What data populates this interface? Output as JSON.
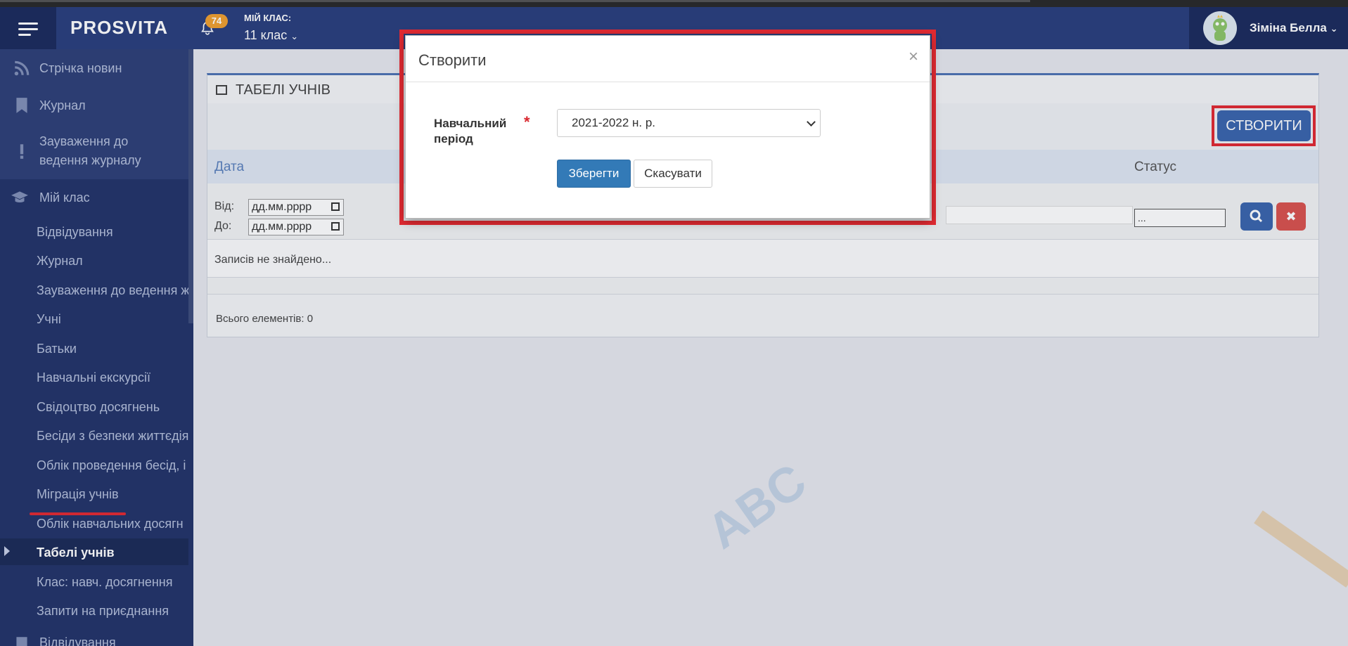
{
  "topbar": {
    "logo": "PROSVITA",
    "notifications_count": "74",
    "my_class_label": "МІЙ КЛАС:",
    "my_class_value": "11 клас",
    "user_name": "Зіміна Белла"
  },
  "sidebar": {
    "items": [
      {
        "label": "Стрічка новин",
        "icon": "rss-icon"
      },
      {
        "label": "Журнал",
        "icon": "bookmark-icon"
      },
      {
        "label": "Зауваження до ведення журналу",
        "icon": "exclamation-icon"
      },
      {
        "label": "Мій клас",
        "icon": "graduation-cap-icon"
      }
    ],
    "subitems": [
      "Відвідування",
      "Журнал",
      "Зауваження до ведення ж",
      "Учні",
      "Батьки",
      "Навчальні екскурсії",
      "Свідоцтво досягнень",
      "Бесіди з безпеки життєдія",
      "Облік проведення бесід, і",
      "Міграція учнів",
      "Облік навчальних досягн",
      "Табелі учнів",
      "Клас: навч. досягнення",
      "Запити на приєднання"
    ],
    "bottom_item": "Відвідування"
  },
  "panel": {
    "title": "ТАБЕЛІ УЧНІВ",
    "create_button": "СТВОРИТИ",
    "col_date": "Дата",
    "col_status": "Статус",
    "from_label": "Від:",
    "to_label": "До:",
    "date_placeholder": "дд.мм.рррр",
    "status_value": "...",
    "empty_text": "Записів не знайдено...",
    "total_text": "Всього елементів: 0"
  },
  "modal": {
    "title": "Створити",
    "close": "×",
    "field_label": "Навчальний період",
    "required_mark": "*",
    "period_value": "2021-2022 н. р.",
    "save_button": "Зберегти",
    "cancel_button": "Скасувати"
  },
  "colors": {
    "accent": "#3b65ad",
    "highlight": "#e12a32",
    "sidebar": "#2f4178"
  }
}
